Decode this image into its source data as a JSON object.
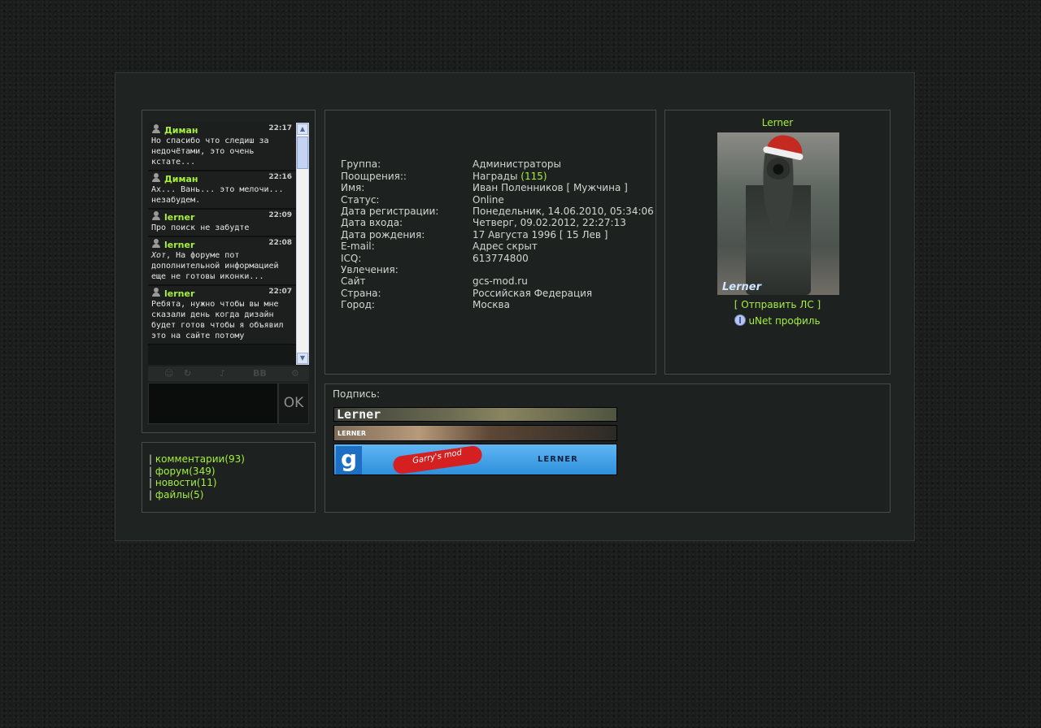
{
  "chat": {
    "messages": [
      {
        "author": "Диман",
        "time": "22:17",
        "text": "Но спасибо что следиш за недочётами, это очень кстате..."
      },
      {
        "author": "Диман",
        "time": "22:16",
        "text": "Ах... Вань... это мелочи... незабудем."
      },
      {
        "author": "lerner",
        "time": "22:09",
        "text": "Про поиск не забудте"
      },
      {
        "author": "lerner",
        "time": "22:08",
        "mention": "Хот",
        "text": ", На форуме пот дополнительной информацией еще не готовы иконки..."
      },
      {
        "author": "lerner",
        "time": "22:07",
        "text": "Ребята, нужно чтобы вы мне сказали день когда дизайн будет готов чтобы я объявил это на сайте потому"
      }
    ],
    "toolbar_icons": [
      "smiley-icon",
      "refresh-icon",
      "sound-icon",
      "bbcode-icon",
      "settings-icon"
    ],
    "toolbar_bb": "BB",
    "input_value": "",
    "ok_label": "OK"
  },
  "stats": {
    "separator": "|",
    "items": [
      {
        "label": "комментарии",
        "count": "(93)"
      },
      {
        "label": "форум",
        "count": "(349)"
      },
      {
        "label": "новости",
        "count": "(11)"
      },
      {
        "label": "файлы",
        "count": "(5)"
      }
    ]
  },
  "info": {
    "rows": [
      {
        "label": "Группа:",
        "value": "Администраторы"
      },
      {
        "label": "Поощрения::",
        "value": "Награды",
        "extra": "(115)"
      },
      {
        "label": "Имя:",
        "value": "Иван Поленников [ Мужчина ]"
      },
      {
        "label": "Статус:",
        "value": "Online"
      },
      {
        "label": "Дата регистрации:",
        "value": "Понедельник, 14.06.2010, 05:34:06"
      },
      {
        "label": "Дата входа:",
        "value": "Четверг, 09.02.2012, 22:27:13"
      },
      {
        "label": "Дата рождения:",
        "value": "17 Августа 1996 [ 15 Лев ]"
      },
      {
        "label": "E-mail:",
        "value": "Адрес скрыт"
      },
      {
        "label": "ICQ:",
        "value": "613774800"
      },
      {
        "label": "Увлечения:",
        "value": ""
      },
      {
        "label": "Сайт",
        "value": "gcs-mod.ru"
      },
      {
        "label": "Страна:",
        "value": "Российская Федерация"
      },
      {
        "label": "Город:",
        "value": "Москва"
      }
    ]
  },
  "profile": {
    "username": "Lerner",
    "avatar_caption": "Lerner",
    "send_pm": "Отправить ЛС",
    "bracket_open": "[",
    "bracket_close": "]",
    "unet_link": "uNet профиль"
  },
  "signature": {
    "label": "Подпись:",
    "banner1_text": "Lerner",
    "banner2_text": "LERNER",
    "banner3_logo": "g",
    "banner3_tag": "Garry's mod",
    "banner3_text": "LERNER"
  },
  "colors": {
    "accent": "#a6f03b",
    "panel": "#1f2322",
    "text": "#d2d6cf"
  }
}
